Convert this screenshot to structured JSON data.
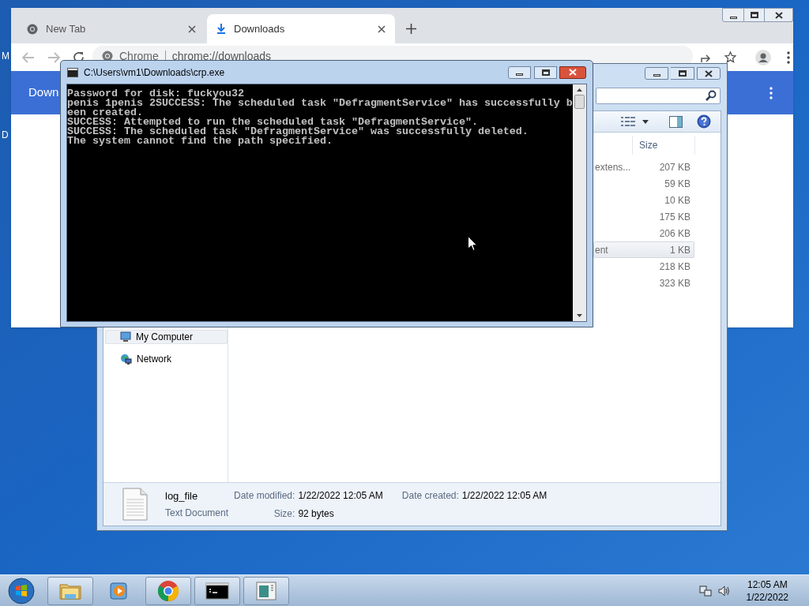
{
  "desktop": {
    "icon_labels": [
      "M",
      "D"
    ]
  },
  "browser": {
    "tabs": [
      {
        "title": "New Tab",
        "selected": false
      },
      {
        "title": "Downloads",
        "selected": true
      }
    ],
    "omnibox": {
      "chip": "Chrome",
      "url": "chrome://downloads"
    },
    "banner_title": "Down"
  },
  "explorer": {
    "columns": [
      "Size"
    ],
    "rows": [
      {
        "type": "extens...",
        "size": "207 KB",
        "selected": false
      },
      {
        "size": "59 KB",
        "selected": false
      },
      {
        "size": "10 KB",
        "selected": false
      },
      {
        "size": "175 KB",
        "selected": false
      },
      {
        "size": "206 KB",
        "selected": false
      },
      {
        "type": "ent",
        "size": "1 KB",
        "selected": true
      },
      {
        "size": "218 KB",
        "selected": false
      },
      {
        "size": "323 KB",
        "selected": false
      }
    ],
    "nav": [
      {
        "label": "My Computer",
        "kind": "computer",
        "selected": true
      },
      {
        "label": "Network",
        "kind": "network",
        "selected": false
      }
    ],
    "details": {
      "name": "log_file",
      "type": "Text Document",
      "fields": [
        {
          "label": "Date modified:",
          "value": "1/22/2022 12:05 AM"
        },
        {
          "label": "Date created:",
          "value": "1/22/2022 12:05 AM"
        },
        {
          "label": "Size:",
          "value": "92 bytes"
        }
      ]
    }
  },
  "console": {
    "title": "C:\\Users\\vm1\\Downloads\\crp.exe",
    "lines": [
      "Password for disk: fuckyou32",
      "penis 1penis 2SUCCESS: The scheduled task \"DefragmentService\" has successfully b",
      "een created.",
      "SUCCESS: Attempted to run the scheduled task \"DefragmentService\".",
      "SUCCESS: The scheduled task \"DefragmentService\" was successfully deleted.",
      "The system cannot find the path specified."
    ]
  },
  "taskbar": {
    "items": [
      {
        "kind": "explorer",
        "running": true
      },
      {
        "kind": "media",
        "running": false
      },
      {
        "kind": "chrome",
        "running": true
      },
      {
        "kind": "console",
        "running": true
      },
      {
        "kind": "window",
        "running": true
      }
    ],
    "clock": {
      "time": "12:05 AM",
      "date": "1/22/2022"
    }
  }
}
